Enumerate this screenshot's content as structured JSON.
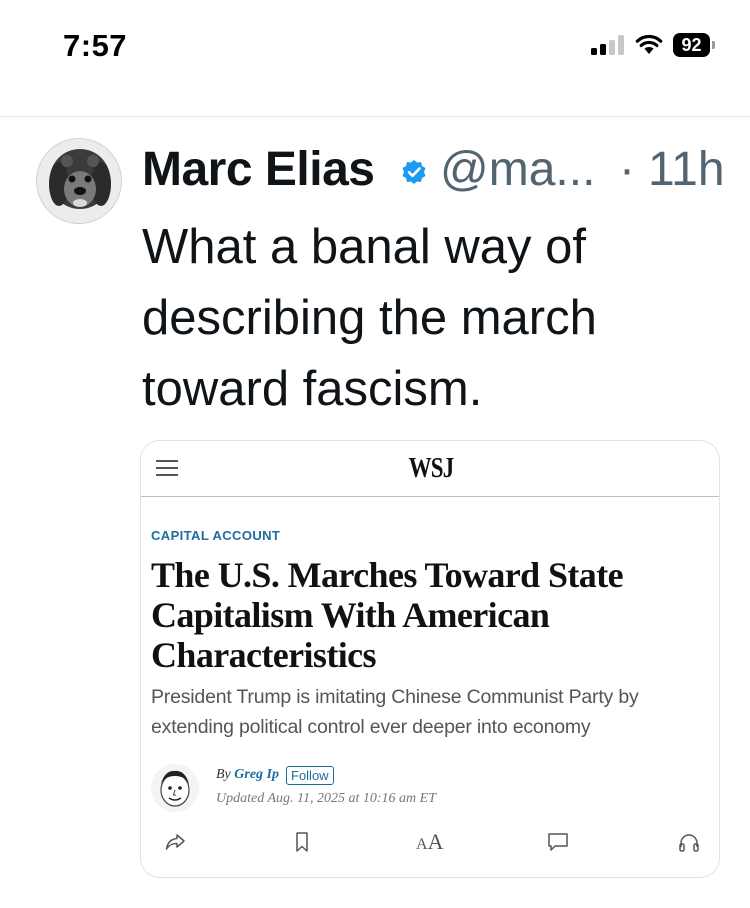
{
  "status_bar": {
    "time": "7:57",
    "battery": "92"
  },
  "tweet": {
    "author_name": "Marc Elias",
    "handle": "@ma...",
    "separator": "·",
    "time_ago": "11h",
    "text": "What a banal way of describing the march toward fascism.",
    "verified_color": "#1d9bf0"
  },
  "card": {
    "publication": "WSJ",
    "section": "CAPITAL ACCOUNT",
    "headline": "The U.S. Marches Toward State Capitalism With American Characteristics",
    "dek": "President Trump is imitating Chinese Communist Party by extending political control ever deeper into economy",
    "byline_prefix": "By",
    "byline_author": "Greg Ip",
    "follow_label": "Follow",
    "updated": "Updated Aug. 11, 2025 at 10:16 am ET",
    "text_size_label_small": "A",
    "text_size_label_big": "A",
    "accent_color": "#1c6ca1",
    "icons": [
      "share-icon",
      "bookmark-icon",
      "text-size-icon",
      "comment-icon",
      "headphones-icon"
    ]
  }
}
